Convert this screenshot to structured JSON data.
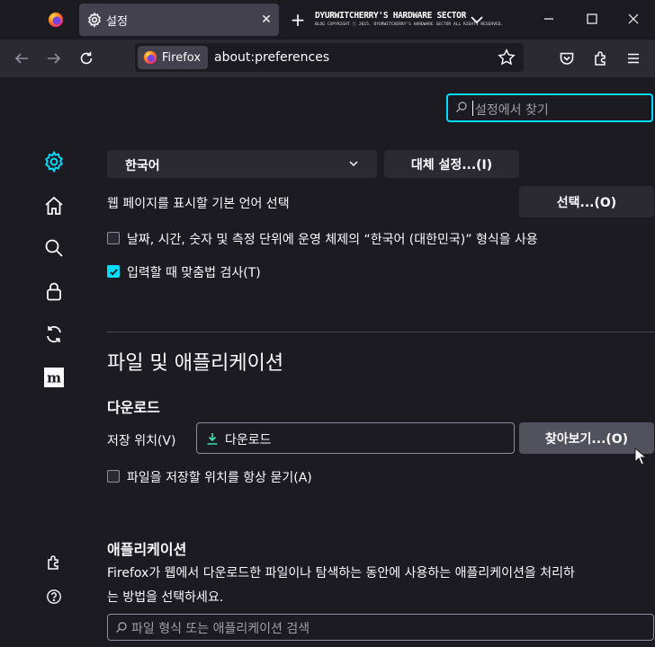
{
  "tabstrip": {
    "tab_title": "설정",
    "banner_title": "DYURWITCHERRY'S HARDWARE SECTOR",
    "banner_subtitle": "BLOG COPYRIGHT ⓒ 2015. DYURWITCHERRY'S HARDWARE SECTOR ALL RIGHTS RESERVED."
  },
  "navbar": {
    "identity_label": "Firefox",
    "url": "about:preferences"
  },
  "search": {
    "placeholder": "설정에서 찾기"
  },
  "language": {
    "selected": "한국어",
    "alternatives_button": "대체 설정...(I)",
    "web_lang_label": "웹 페이지를 표시할 기본 언어 선택",
    "choose_button": "선택...(O)",
    "os_locale_checkbox": "날짜, 시간, 숫자 및 측정 단위에 운영 체제의 “한국어 (대한민국)” 형식을 사용",
    "os_locale_checked": false,
    "spellcheck_checkbox": "입력할 때 맞춤법 검사(T)",
    "spellcheck_checked": true
  },
  "files_apps": {
    "heading": "파일 및 애플리케이션",
    "downloads_heading": "다운로드",
    "save_location_label": "저장 위치(V)",
    "download_folder": "다운로드",
    "browse_button": "찾아보기...(O)",
    "always_ask_checkbox": "파일을 저장할 위치를 항상 묻기(A)",
    "always_ask_checked": false,
    "apps_heading": "애플리케이션",
    "apps_desc_line1": "Firefox가 웹에서 다운로드한 파일이나 탐색하는 동안에 사용하는 애플리케이션을 처리하",
    "apps_desc_line2": "는 방법을 선택하세요.",
    "apps_search_placeholder": "파일 형식 또는 애플리케이션 검색"
  },
  "colors": {
    "accent": "#00ddff",
    "background": "#1c1b22",
    "surface": "#2b2a33"
  },
  "icons": [
    "firefox-icon",
    "gear-icon",
    "close-icon",
    "plus-icon",
    "chevron-down-icon",
    "minimize-icon",
    "maximize-icon",
    "back-icon",
    "forward-icon",
    "reload-icon",
    "star-icon",
    "pocket-icon",
    "extensions-icon",
    "menu-icon",
    "home-icon",
    "search-icon",
    "lock-icon",
    "sync-icon",
    "mozilla-icon",
    "addons-icon",
    "help-icon",
    "download-icon"
  ]
}
